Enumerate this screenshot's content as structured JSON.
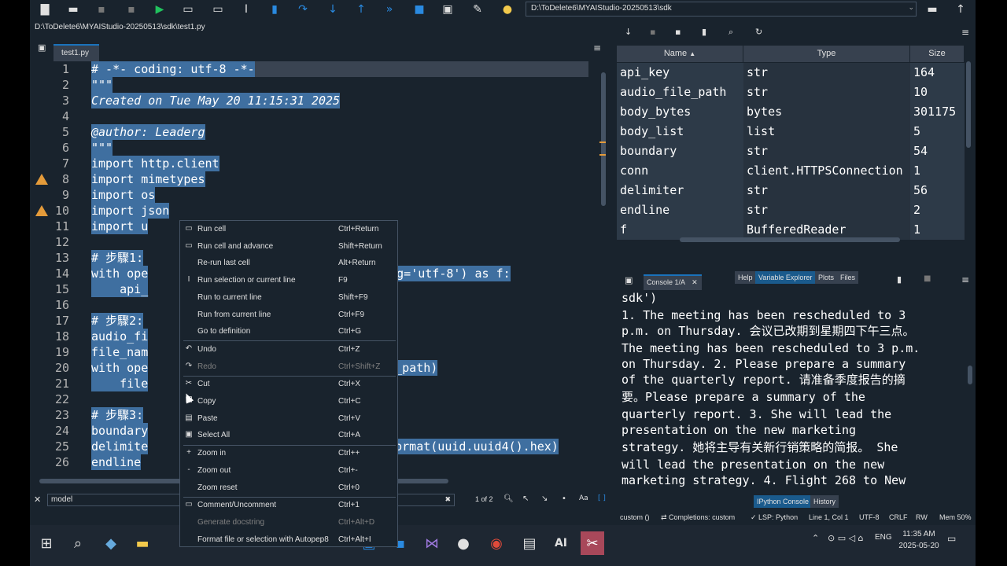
{
  "toolbar": {
    "path": "D:\\ToDelete6\\MYAIStudio-20250513\\sdk",
    "icons": [
      "new-file-icon",
      "open-folder-icon",
      "save-icon",
      "save-all-icon",
      "run-icon",
      "run-cell-icon",
      "run-cell-advance-icon",
      "run-selection-icon",
      "debug-icon",
      "step-icon",
      "step-into-icon",
      "step-return-icon",
      "continue-icon",
      "stop-icon",
      "maximize-pane-icon",
      "preferences-icon",
      "python-path-icon"
    ]
  },
  "breadcrumb": "D:\\ToDelete6\\MYAIStudio-20250513\\sdk\\test1.py",
  "editor": {
    "tab": "test1.py",
    "lines": [
      {
        "n": "1",
        "t": "# -*- coding: utf-8 -*-",
        "sel": true
      },
      {
        "n": "2",
        "t": "\"\"\"",
        "sel": true
      },
      {
        "n": "3",
        "t": "Created on Tue May 20 11:15:31 2025",
        "sel": true
      },
      {
        "n": "4",
        "t": "",
        "sel": false
      },
      {
        "n": "5",
        "t": "@author: Leaderg",
        "sel": true
      },
      {
        "n": "6",
        "t": "\"\"\"",
        "sel": true
      },
      {
        "n": "7",
        "t": "import http.client",
        "sel": true
      },
      {
        "n": "8",
        "t": "import mimetypes",
        "sel": true
      },
      {
        "n": "9",
        "t": "import os",
        "sel": true
      },
      {
        "n": "10",
        "t": "import json",
        "sel": true
      },
      {
        "n": "11",
        "t": "import u",
        "sel": true
      },
      {
        "n": "12",
        "t": "",
        "sel": false
      },
      {
        "n": "13",
        "t": "# 步驟1:",
        "sel": true
      },
      {
        "n": "14",
        "t": "with ope",
        "sel": true
      },
      {
        "n": "15",
        "t": "    api_",
        "sel": true
      },
      {
        "n": "16",
        "t": "",
        "sel": false
      },
      {
        "n": "17",
        "t": "# 步驟2:",
        "sel": true
      },
      {
        "n": "18",
        "t": "audio_fi",
        "sel": true
      },
      {
        "n": "19",
        "t": "file_nam",
        "sel": true
      },
      {
        "n": "20",
        "t": "with ope",
        "sel": true
      },
      {
        "n": "21",
        "t": "    file",
        "sel": true
      },
      {
        "n": "22",
        "t": "",
        "sel": false
      },
      {
        "n": "23",
        "t": "# 步驟3:",
        "sel": true
      },
      {
        "n": "24",
        "t": "boundary",
        "sel": true
      },
      {
        "n": "25",
        "t": "delimite",
        "sel": true
      },
      {
        "n": "26",
        "t": "endline",
        "sel": true
      }
    ],
    "tails": [
      {
        "row": 13,
        "t": "coding='utf-8') as f:"
      },
      {
        "row": 19,
        "t": "file_path)"
      },
      {
        "row": 20,
        "t": " f:"
      },
      {
        "row": 24,
        "t": "}'.format(uuid.uuid4().hex)"
      }
    ],
    "warnings": [
      "8",
      "10"
    ]
  },
  "findbar": {
    "value": "model",
    "count": "1 of 2",
    "close": "✕"
  },
  "variable_explorer": {
    "headers": [
      "Name",
      "Type",
      "Size"
    ],
    "rows": [
      {
        "name": "api_key",
        "type": "str",
        "size": "164"
      },
      {
        "name": "audio_file_path",
        "type": "str",
        "size": "10"
      },
      {
        "name": "body_bytes",
        "type": "bytes",
        "size": "301175"
      },
      {
        "name": "body_list",
        "type": "list",
        "size": "5"
      },
      {
        "name": "boundary",
        "type": "str",
        "size": "54"
      },
      {
        "name": "conn",
        "type": "client.HTTPSConnection",
        "size": "1"
      },
      {
        "name": "delimiter",
        "type": "str",
        "size": "56"
      },
      {
        "name": "endline",
        "type": "str",
        "size": "2"
      },
      {
        "name": "f",
        "type": "BufferedReader",
        "size": "1"
      }
    ],
    "pane_tabs": [
      "Help",
      "Variable Explorer",
      "Plots",
      "Files"
    ]
  },
  "console": {
    "tab": "Console 1/A",
    "lines": [
      "sdk')",
      "1. The meeting has been rescheduled to 3",
      "p.m. on Thursday. 会议已改期到星期四下午三点。",
      "The meeting has been rescheduled to 3 p.m.",
      "on Thursday. 2. Please prepare a summary",
      "of the quarterly report. 请准备季度报告的摘",
      "要。Please prepare a summary of the",
      "quarterly report. 3. She will lead the",
      "presentation on the new marketing",
      "strategy. 她将主导有关新行销策略的简报。 She",
      "will lead the presentation on the new",
      "marketing strategy. 4. Flight 268 to New",
      "York has been delayed due to weather"
    ],
    "pane_tabs": [
      "IPython Console",
      "History"
    ]
  },
  "status": {
    "env": "custom ()",
    "completions": "Completions: custom",
    "lsp": "LSP: Python",
    "pos": "Line 1, Col 1",
    "enc": "UTF-8",
    "eol": "CRLF",
    "rw": "RW",
    "mem": "Mem 50%"
  },
  "context_menu": {
    "items": [
      {
        "label": "Run cell",
        "sc": "Ctrl+Return",
        "icon": "▭",
        "dis": false
      },
      {
        "label": "Run cell and advance",
        "sc": "Shift+Return",
        "icon": "▭",
        "dis": false
      },
      {
        "label": "Re-run last cell",
        "sc": "Alt+Return",
        "icon": "",
        "dis": false
      },
      {
        "label": "Run selection or current line",
        "sc": "F9",
        "icon": "I",
        "dis": false
      },
      {
        "label": "Run to current line",
        "sc": "Shift+F9",
        "icon": "",
        "dis": false
      },
      {
        "label": "Run from current line",
        "sc": "Ctrl+F9",
        "icon": "",
        "dis": false
      },
      {
        "label": "Go to definition",
        "sc": "Ctrl+G",
        "icon": "",
        "dis": false
      },
      {
        "label": "Undo",
        "sc": "Ctrl+Z",
        "icon": "↶",
        "dis": false
      },
      {
        "label": "Redo",
        "sc": "Ctrl+Shift+Z",
        "icon": "↷",
        "dis": true
      },
      {
        "label": "Cut",
        "sc": "Ctrl+X",
        "icon": "✂",
        "dis": false
      },
      {
        "label": "Copy",
        "sc": "Ctrl+C",
        "icon": "❐",
        "dis": false
      },
      {
        "label": "Paste",
        "sc": "Ctrl+V",
        "icon": "▤",
        "dis": false
      },
      {
        "label": "Select All",
        "sc": "Ctrl+A",
        "icon": "▣",
        "dis": false
      },
      {
        "label": "Zoom in",
        "sc": "Ctrl++",
        "icon": "+",
        "dis": false
      },
      {
        "label": "Zoom out",
        "sc": "Ctrl+-",
        "icon": "-",
        "dis": false
      },
      {
        "label": "Zoom reset",
        "sc": "Ctrl+0",
        "icon": "",
        "dis": false
      },
      {
        "label": "Comment/Uncomment",
        "sc": "Ctrl+1",
        "icon": "▭",
        "dis": false
      },
      {
        "label": "Generate docstring",
        "sc": "Ctrl+Alt+D",
        "icon": "",
        "dis": true
      },
      {
        "label": "Format file or selection with Autopep8",
        "sc": "Ctrl+Alt+I",
        "icon": "",
        "dis": false
      }
    ]
  },
  "taskbar": {
    "time": "11:35 AM",
    "date": "2025-05-20",
    "lang": "ENG",
    "ai_label": "AI"
  }
}
